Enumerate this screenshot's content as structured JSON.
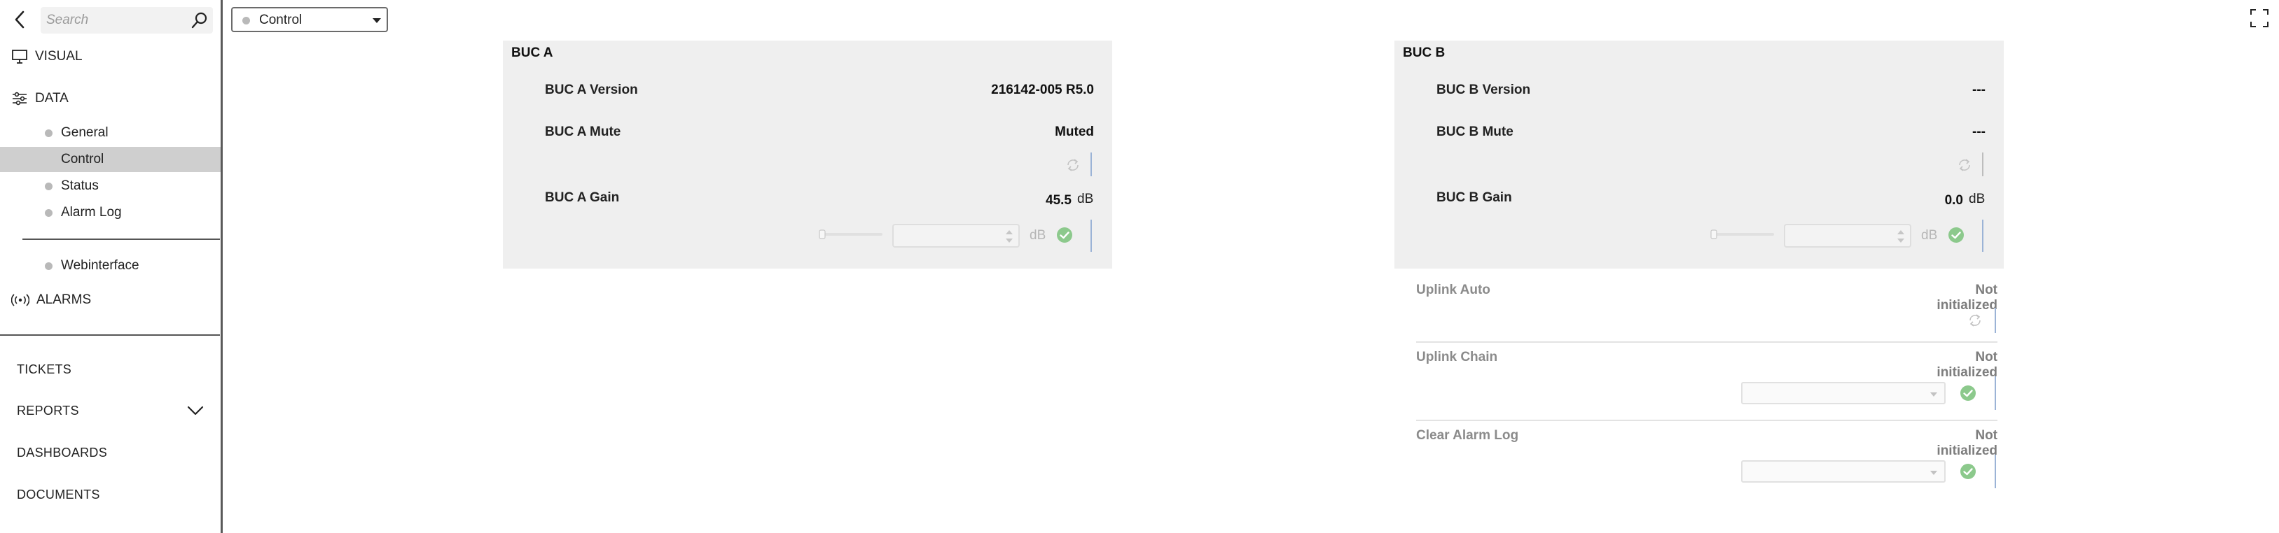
{
  "sidebar": {
    "search_placeholder": "Search",
    "visual_label": "VISUAL",
    "data_label": "DATA",
    "sub_items": [
      {
        "label": "General"
      },
      {
        "label": "Control"
      },
      {
        "label": "Status"
      },
      {
        "label": "Alarm Log"
      },
      {
        "label": "Webinterface"
      }
    ],
    "alarms_label": "ALARMS",
    "bottom_items": [
      {
        "label": "TICKETS"
      },
      {
        "label": "REPORTS"
      },
      {
        "label": "DASHBOARDS"
      },
      {
        "label": "DOCUMENTS"
      }
    ]
  },
  "page_select": {
    "value": "Control"
  },
  "buc_a": {
    "title": "BUC A",
    "version_label": "BUC A Version",
    "version_value": "216142-005 R5.0",
    "mute_label": "BUC A Mute",
    "mute_value": "Muted",
    "gain_label": "BUC A Gain",
    "gain_value": "45.5",
    "gain_unit": "dB",
    "input_unit": "dB"
  },
  "buc_b": {
    "title": "BUC B",
    "version_label": "BUC B Version",
    "version_value": "---",
    "mute_label": "BUC B Mute",
    "mute_value": "---",
    "gain_label": "BUC B Gain",
    "gain_value": "0.0",
    "gain_unit": "dB",
    "input_unit": "dB"
  },
  "extra": {
    "uplink_auto_label": "Uplink Auto",
    "uplink_auto_value": "Not initialized",
    "uplink_chain_label": "Uplink Chain",
    "uplink_chain_value": "Not initialized",
    "clear_alarm_label": "Clear Alarm Log",
    "clear_alarm_value": "Not initialized"
  },
  "colors": {
    "active_item": "#cfcfcf",
    "panel_bg": "#efefef",
    "check_green": "#8cc98c",
    "accent_line": "#9bb3d6"
  }
}
